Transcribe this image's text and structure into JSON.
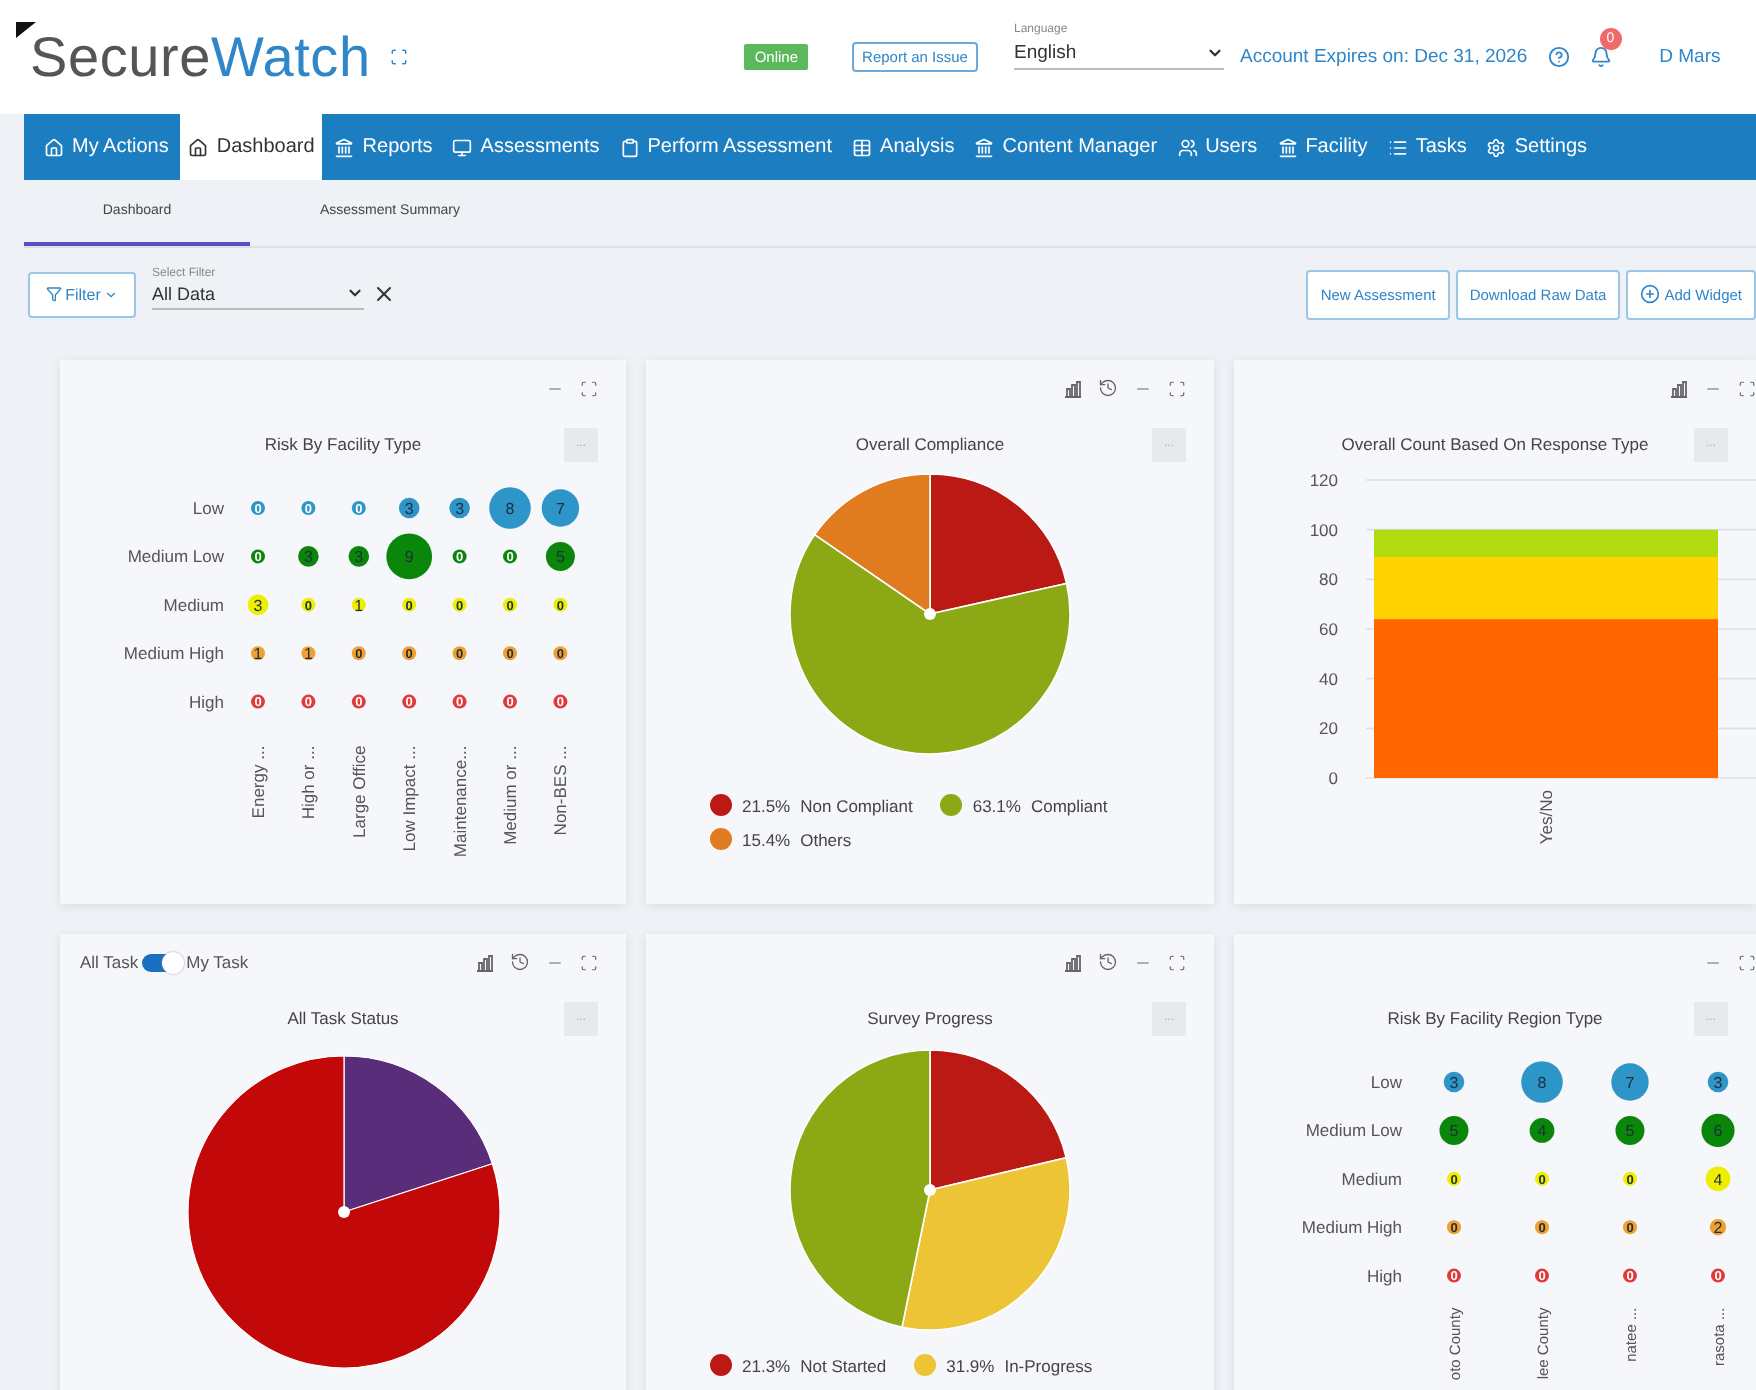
{
  "header": {
    "logo": {
      "part_1": "Secure",
      "part_2": "Watch"
    },
    "status_badge": "Online",
    "report_button": "Report an Issue",
    "language": {
      "label": "Language",
      "value": "English"
    },
    "account_expiry": "Account Expires on: Dec 31, 2026",
    "notifications_count": "0",
    "user_name": "D Mars"
  },
  "nav": [
    {
      "label": "My Actions",
      "selected": false
    },
    {
      "label": "Dashboard",
      "selected": true
    },
    {
      "label": "Reports",
      "selected": false
    },
    {
      "label": "Assessments",
      "selected": false
    },
    {
      "label": "Perform Assessment",
      "selected": false
    },
    {
      "label": "Analysis",
      "selected": false
    },
    {
      "label": "Content Manager",
      "selected": false
    },
    {
      "label": "Users",
      "selected": false
    },
    {
      "label": "Facility",
      "selected": false
    },
    {
      "label": "Tasks",
      "selected": false
    },
    {
      "label": "Settings",
      "selected": false
    }
  ],
  "subtabs": [
    {
      "label": "Dashboard",
      "selected": true
    },
    {
      "label": "Assessment Summary",
      "selected": false
    }
  ],
  "filter": {
    "button": "Filter",
    "label": "Select Filter",
    "value": "All Data"
  },
  "actions": [
    {
      "label": "New Assessment",
      "kind": "plain"
    },
    {
      "label": "Download Raw Data",
      "kind": "plain"
    },
    {
      "label": "Add Widget",
      "kind": "add"
    }
  ],
  "widgets": [
    {
      "kind": "bubble",
      "title": "Risk By Facility Type",
      "more": "...",
      "columns": [
        "Energy ...",
        "High or ...",
        "Large Office",
        "Low Impact ...",
        "Maintenance...",
        "Medium or ...",
        "Non-BES ..."
      ],
      "rows": [
        {
          "label": "Low",
          "color": "#2e95c9",
          "values": [
            "0",
            "0",
            "0",
            "3",
            "3",
            "8",
            "7"
          ]
        },
        {
          "label": "Medium Low",
          "color": "#0a870a",
          "values": [
            "0",
            "3",
            "3",
            "9",
            "0",
            "0",
            "5"
          ]
        },
        {
          "label": "Medium",
          "color": "#eeee00",
          "values": [
            "3",
            "0",
            "1",
            "0",
            "0",
            "0",
            "0"
          ]
        },
        {
          "label": "Medium High",
          "color": "#f0a030",
          "values": [
            "1",
            "1",
            "0",
            "0",
            "0",
            "0",
            "0"
          ]
        },
        {
          "label": "High",
          "color": "#e03a3a",
          "values": [
            "0",
            "0",
            "0",
            "0",
            "0",
            "0",
            "0"
          ]
        }
      ]
    },
    {
      "kind": "pie",
      "title": "Overall Compliance",
      "more": "...",
      "chart_data": {
        "type": "pie",
        "values": [
          21.5,
          63.1,
          15.4
        ],
        "colors": [
          "#bb1a14",
          "#8ca815",
          "#e07b20"
        ]
      },
      "legend": [
        {
          "value": "21.5%",
          "label": "Non Compliant",
          "color": "#bb1a14"
        },
        {
          "value": "63.1%",
          "label": "Compliant",
          "color": "#8ca815"
        },
        {
          "value": "15.4%",
          "label": "Others",
          "color": "#e07b20"
        }
      ]
    },
    {
      "kind": "bar",
      "title": "Overall Count Based On Response Type",
      "more": "...",
      "chart_data": {
        "type": "bar",
        "stacked": true,
        "categories": [
          "Yes/No"
        ],
        "series": [
          {
            "color": "#ff6600",
            "values": [
              64
            ]
          },
          {
            "color": "#ffd200",
            "values": [
              25
            ]
          },
          {
            "color": "#b2dc12",
            "values": [
              11
            ]
          }
        ],
        "grid": true,
        "ylim": [
          0,
          120
        ],
        "yticks": [
          0,
          20,
          40,
          60,
          80,
          100,
          120
        ]
      }
    },
    {
      "kind": "task_pie",
      "title": "All Task Status",
      "more": "...",
      "toggle": {
        "left": "All Task",
        "right": "My Task",
        "on": true
      }
    },
    {
      "kind": "pie",
      "title": "Survey Progress",
      "more": "...",
      "chart_data": {
        "type": "pie",
        "values": [
          21.3,
          31.9,
          46.8
        ],
        "colors": [
          "#bb1a14",
          "#ecc435",
          "#8ca815"
        ]
      },
      "legend": [
        {
          "value": "21.3%",
          "label": "Not Started",
          "color": "#bb1a14"
        },
        {
          "value": "31.9%",
          "label": "In-Progress",
          "color": "#ecc435"
        }
      ]
    },
    {
      "kind": "bubble",
      "title": "Risk By Facility Region Type",
      "more": "...",
      "columns": [
        "oto County",
        "lee County",
        "natee ...",
        "rasota ..."
      ],
      "rows": [
        {
          "label": "Low",
          "color": "#2e95c9",
          "values": [
            "3",
            "8",
            "7",
            "3"
          ]
        },
        {
          "label": "Medium Low",
          "color": "#0a870a",
          "values": [
            "5",
            "4",
            "5",
            "6"
          ]
        },
        {
          "label": "Medium",
          "color": "#eeee00",
          "values": [
            "0",
            "0",
            "0",
            "4"
          ]
        },
        {
          "label": "Medium High",
          "color": "#f0a030",
          "values": [
            "0",
            "0",
            "0",
            "2"
          ]
        },
        {
          "label": "High",
          "color": "#e03a3a",
          "values": [
            "0",
            "0",
            "0",
            "0"
          ]
        }
      ]
    }
  ]
}
